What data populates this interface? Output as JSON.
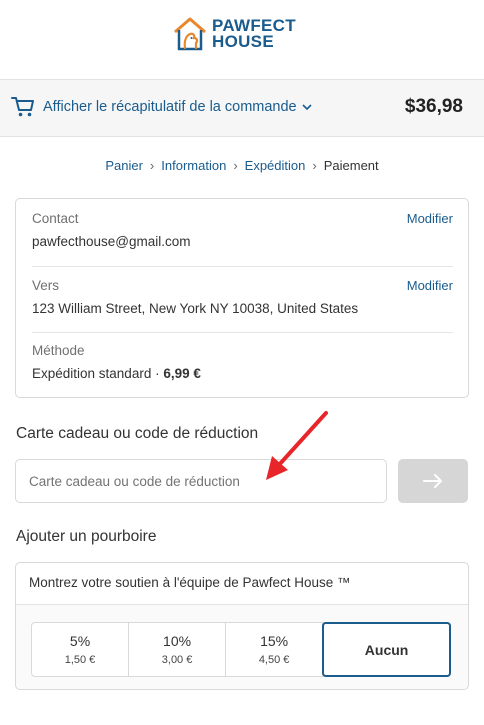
{
  "logo": {
    "line1": "PAWFECT",
    "line2": "HOUSE",
    "color": "#1a5c8e",
    "accent": "#e8872c"
  },
  "summary": {
    "toggle_label": "Afficher le récapitulatif de la commande",
    "total": "$36,98"
  },
  "breadcrumb": [
    {
      "label": "Panier"
    },
    {
      "label": "Information"
    },
    {
      "label": "Expédition"
    },
    {
      "label": "Paiement"
    }
  ],
  "review": {
    "contact": {
      "label": "Contact",
      "value": "pawfecthouse@gmail.com",
      "edit": "Modifier"
    },
    "ship_to": {
      "label": "Vers",
      "value": "123 William Street, New York NY 10038, United States",
      "edit": "Modifier"
    },
    "method": {
      "label": "Méthode",
      "value": "Expédition standard · ",
      "price": "6,99 €"
    }
  },
  "gift_card": {
    "title": "Carte cadeau ou code de réduction",
    "placeholder": "Carte cadeau ou code de réduction"
  },
  "tip": {
    "title": "Ajouter un pourboire",
    "support_text": "Montrez votre soutien à l'équipe de Pawfect House ™",
    "options": [
      {
        "percent": "5%",
        "amount": "1,50 €"
      },
      {
        "percent": "10%",
        "amount": "3,00 €"
      },
      {
        "percent": "15%",
        "amount": "4,50 €"
      }
    ],
    "none_label": "Aucun"
  },
  "colors": {
    "link": "#1a5c8e",
    "annotation": "#e8262a",
    "button_disabled": "#d6d6d6"
  }
}
